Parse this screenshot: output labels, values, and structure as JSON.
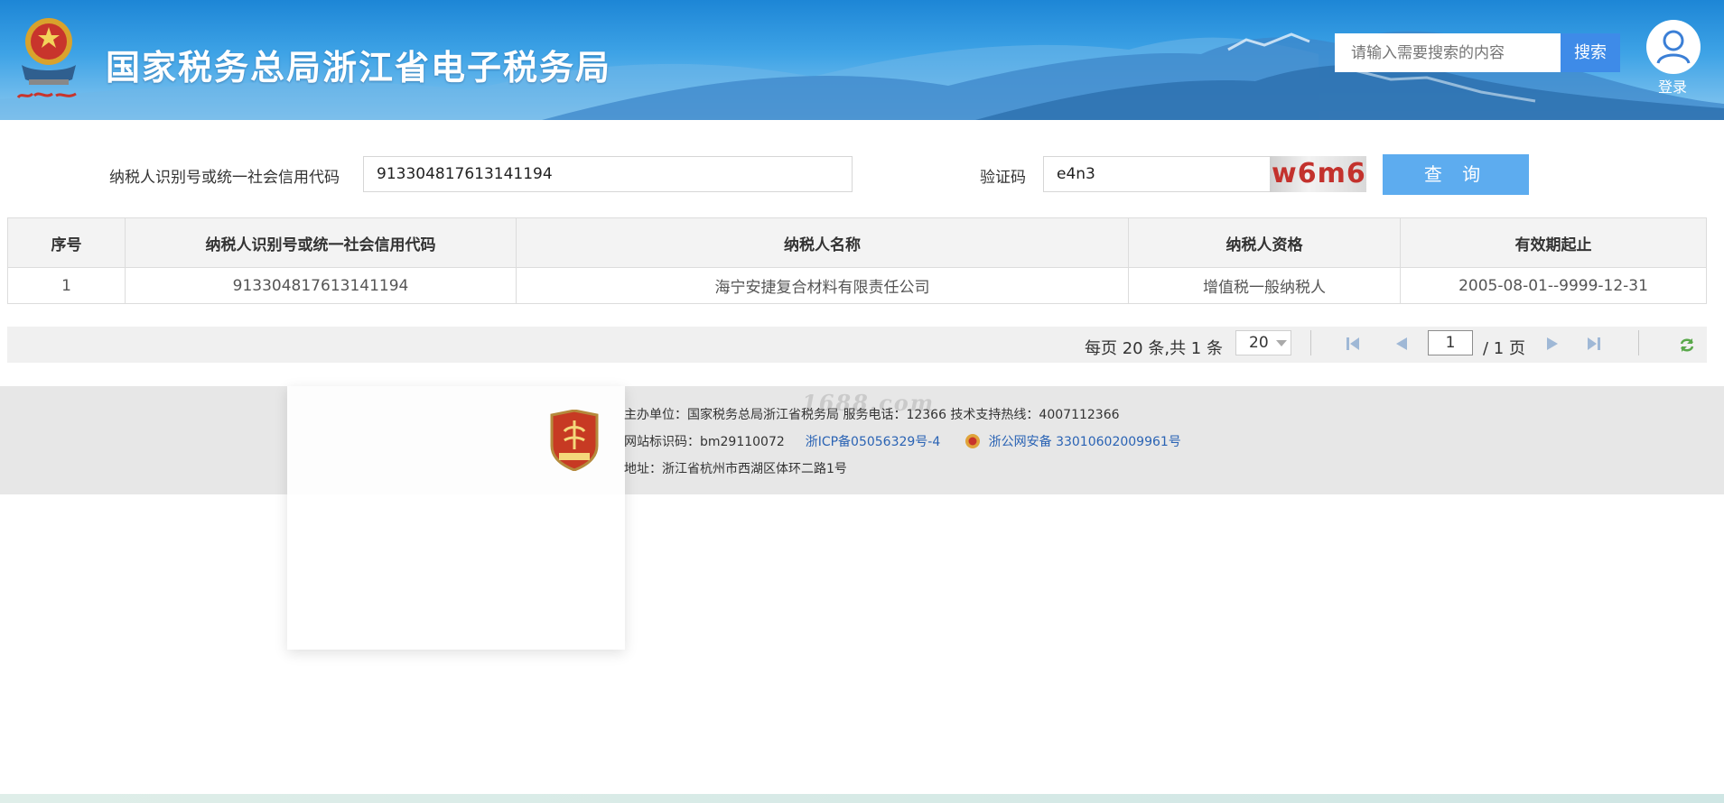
{
  "header": {
    "title": "国家税务总局浙江省电子税务局",
    "search_placeholder": "请输入需要搜索的内容",
    "search_button": "搜索",
    "login_label": "登录",
    "emblem_icon": "tax-bureau-emblem-icon",
    "avatar_icon": "user-icon"
  },
  "query": {
    "taxpayer_id_label": "纳税人识别号或统一社会信用代码",
    "taxpayer_id_value": "913304817613141194",
    "captcha_label": "验证码",
    "captcha_value": "e4n3",
    "captcha_image_text": "w6m6",
    "query_button": "查 询"
  },
  "table": {
    "headers": [
      "序号",
      "纳税人识别号或统一社会信用代码",
      "纳税人名称",
      "纳税人资格",
      "有效期起止"
    ],
    "rows": [
      [
        "1",
        "913304817613141194",
        "海宁安捷复合材料有限责任公司",
        "增值税一般纳税人",
        "2005-08-01--9999-12-31"
      ]
    ]
  },
  "pager": {
    "summary": "每页 20 条,共 1 条",
    "page_size": "20",
    "current_page": "1",
    "total_pages": "/ 1 页"
  },
  "footer": {
    "line1": "主办单位：国家税务总局浙江省税务局    服务电话：12366    技术支持热线：4007112366",
    "site_code": "网站标识码：bm29110072",
    "icp": "浙ICP备05056329号-4",
    "police": "浙公网安备 33010602009961号",
    "address": "地址：浙江省杭州市西湖区体环二路1号",
    "watermark": "1688.com"
  },
  "colors": {
    "header_blue": "#2a8edc",
    "button_blue": "#5dacef",
    "search_button": "#3e8be8",
    "captcha_text": "#c3322d",
    "link_blue": "#2a63b4"
  }
}
